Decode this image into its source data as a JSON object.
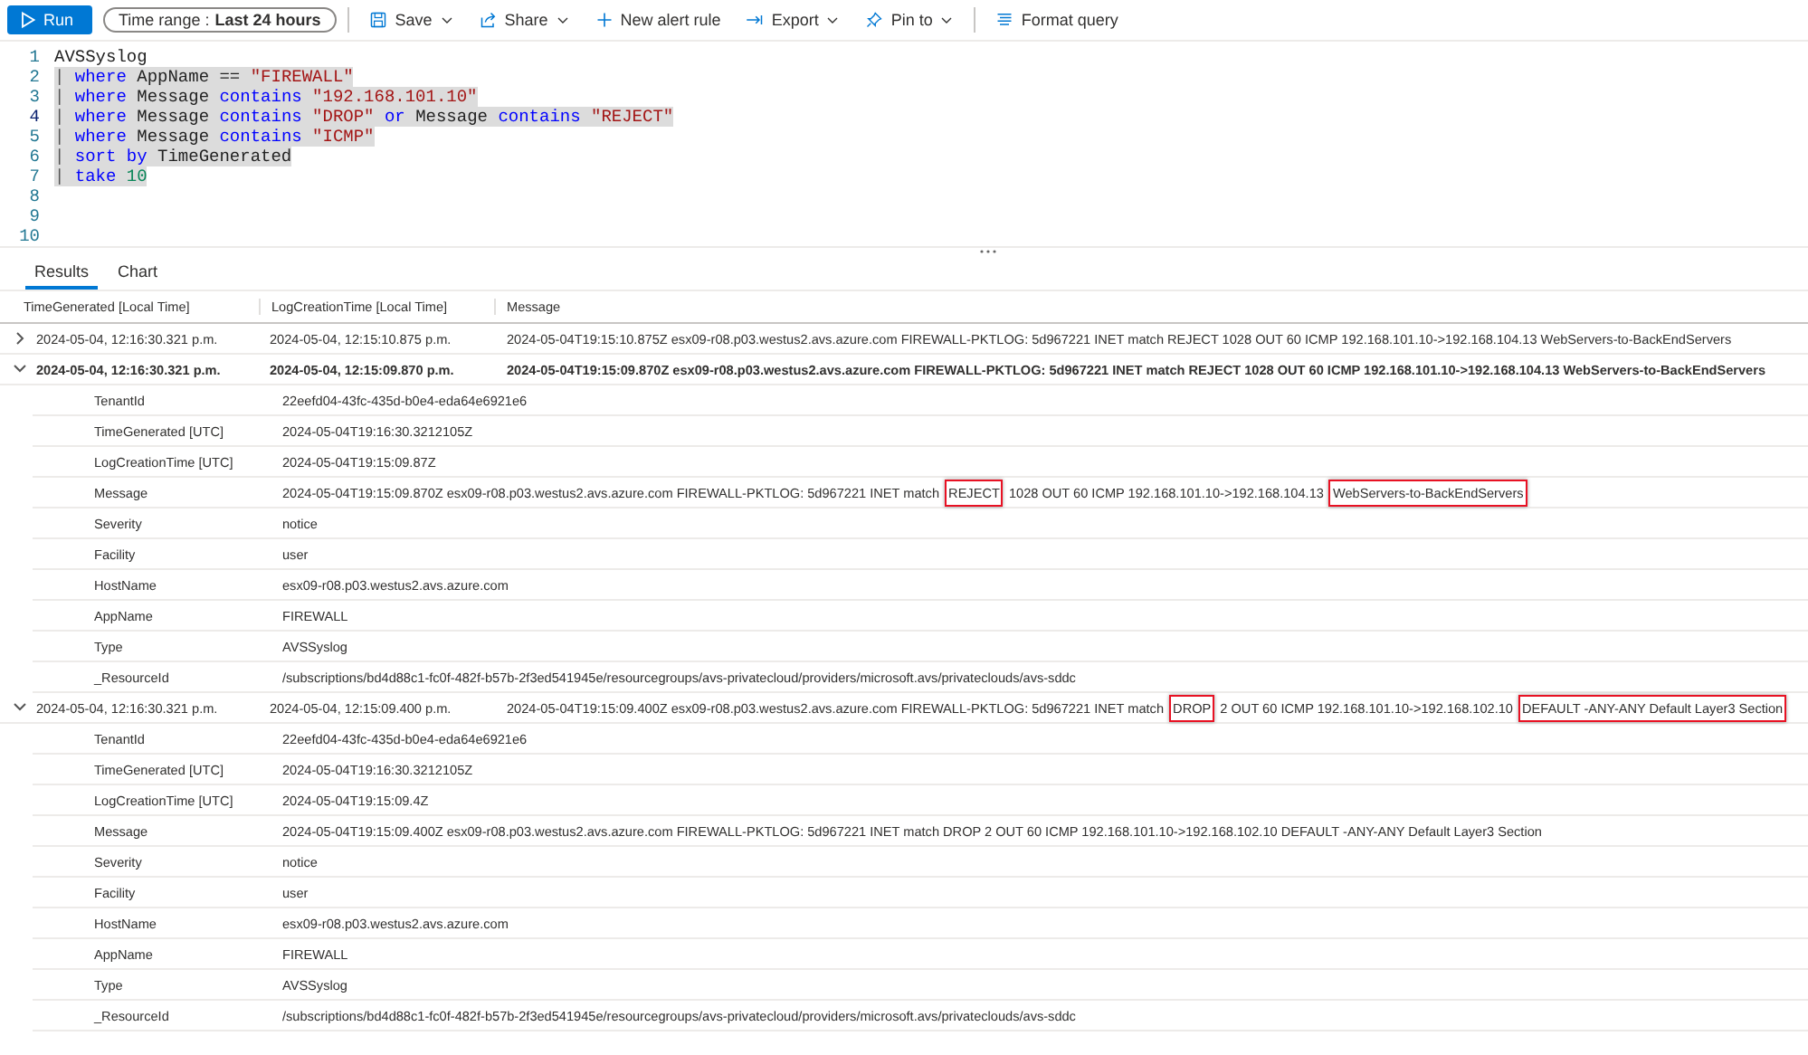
{
  "toolbar": {
    "run_button": {
      "label": "Run"
    },
    "time_range": {
      "label": "Time range :",
      "value": "Last 24 hours"
    },
    "items": [
      {
        "kind": "save",
        "label": "Save",
        "dropdown": true
      },
      {
        "kind": "share",
        "label": "Share",
        "dropdown": true
      },
      {
        "kind": "alert",
        "label": "New alert rule",
        "dropdown": false
      },
      {
        "kind": "export",
        "label": "Export",
        "dropdown": true
      },
      {
        "kind": "pin",
        "label": "Pin to",
        "dropdown": true
      },
      {
        "kind": "format",
        "label": "Format query",
        "dropdown": false
      }
    ]
  },
  "editor": {
    "lines": [
      {
        "number": "1",
        "selected": false,
        "current": false,
        "tokens": [
          {
            "kind": "plain",
            "text": "AVSSyslog"
          }
        ]
      },
      {
        "number": "2",
        "selected": true,
        "current": false,
        "tokens": [
          {
            "kind": "pipe",
            "text": "|"
          },
          {
            "kind": "keyword",
            "text": " where"
          },
          {
            "kind": "plain",
            "text": " AppName == "
          },
          {
            "kind": "string",
            "text": "\"FIREWALL\""
          }
        ]
      },
      {
        "number": "3",
        "selected": true,
        "current": false,
        "tokens": [
          {
            "kind": "pipe",
            "text": "|"
          },
          {
            "kind": "keyword",
            "text": " where"
          },
          {
            "kind": "plain",
            "text": " Message "
          },
          {
            "kind": "keyword",
            "text": "contains"
          },
          {
            "kind": "string",
            "text": " \"192.168.101.10\""
          }
        ]
      },
      {
        "number": "4",
        "selected": true,
        "current": true,
        "tokens": [
          {
            "kind": "pipe",
            "text": "|"
          },
          {
            "kind": "keyword",
            "text": " where"
          },
          {
            "kind": "plain",
            "text": " Message "
          },
          {
            "kind": "keyword",
            "text": "contains"
          },
          {
            "kind": "string",
            "text": " \"DROP\""
          },
          {
            "kind": "keyword",
            "text": " or"
          },
          {
            "kind": "plain",
            "text": " Message "
          },
          {
            "kind": "keyword",
            "text": "contains"
          },
          {
            "kind": "string",
            "text": " \"REJECT\""
          }
        ]
      },
      {
        "number": "5",
        "selected": true,
        "current": false,
        "tokens": [
          {
            "kind": "pipe",
            "text": "|"
          },
          {
            "kind": "keyword",
            "text": " where"
          },
          {
            "kind": "plain",
            "text": " Message "
          },
          {
            "kind": "keyword",
            "text": "contains"
          },
          {
            "kind": "string",
            "text": " \"ICMP\""
          }
        ]
      },
      {
        "number": "6",
        "selected": true,
        "current": false,
        "tokens": [
          {
            "kind": "pipe",
            "text": "|"
          },
          {
            "kind": "keyword",
            "text": " sort by"
          },
          {
            "kind": "plain",
            "text": " TimeGenerated"
          }
        ]
      },
      {
        "number": "7",
        "selected": true,
        "current": false,
        "tokens": [
          {
            "kind": "pipe",
            "text": "|"
          },
          {
            "kind": "keyword",
            "text": " take"
          },
          {
            "kind": "number",
            "text": " 10"
          }
        ]
      },
      {
        "number": "8",
        "current": false
      },
      {
        "number": "9",
        "current": false
      },
      {
        "number": "10",
        "current": false
      }
    ]
  },
  "tabs": [
    {
      "label": "Results",
      "selected": true
    },
    {
      "label": "Chart",
      "selected": false
    }
  ],
  "table": {
    "columns": [
      "TimeGenerated [Local Time]",
      "LogCreationTime [Local Time]",
      "Message"
    ],
    "rows": [
      {
        "expanded": false,
        "selected": false,
        "cells": [
          "2024-05-04, 12:16:30.321 p.m.",
          "2024-05-04, 12:15:10.875 p.m."
        ],
        "message": [
          {
            "text": "2024-05-04T19:15:10.875Z esx09-r08.p03.westus2.avs.azure.com FIREWALL-PKTLOG: 5d967221 INET match REJECT 1028 OUT 60 ICMP 192.168.101.10->192.168.104.13 WebServers-to-BackEndServers",
            "highlighted": false
          }
        ],
        "details": []
      },
      {
        "expanded": true,
        "selected": true,
        "cells": [
          "2024-05-04, 12:16:30.321 p.m.",
          "2024-05-04, 12:15:09.870 p.m."
        ],
        "message": [
          {
            "text": "2024-05-04T19:15:09.870Z esx09-r08.p03.westus2.avs.azure.com FIREWALL-PKTLOG: 5d967221 INET match REJECT 1028 OUT 60 ICMP 192.168.101.10->192.168.104.13 WebServers-to-BackEndServers",
            "highlighted": false
          }
        ],
        "details": [
          {
            "label": "TenantId",
            "value": [
              {
                "text": "22eefd04-43fc-435d-b0e4-eda64e6921e6",
                "highlighted": false
              }
            ]
          },
          {
            "label": "TimeGenerated [UTC]",
            "value": [
              {
                "text": "2024-05-04T19:16:30.3212105Z",
                "highlighted": false
              }
            ]
          },
          {
            "label": "LogCreationTime [UTC]",
            "value": [
              {
                "text": "2024-05-04T19:15:09.87Z",
                "highlighted": false
              }
            ]
          },
          {
            "label": "Message",
            "value": [
              {
                "text": "2024-05-04T19:15:09.870Z esx09-r08.p03.westus2.avs.azure.com FIREWALL-PKTLOG: 5d967221 INET match ",
                "highlighted": false
              },
              {
                "text": "REJECT",
                "highlighted": true
              },
              {
                "text": " 1028 OUT 60 ICMP 192.168.101.10->192.168.104.13 ",
                "highlighted": false
              },
              {
                "text": "WebServers-to-BackEndServers",
                "highlighted": true
              }
            ]
          },
          {
            "label": "Severity",
            "value": [
              {
                "text": "notice",
                "highlighted": false
              }
            ]
          },
          {
            "label": "Facility",
            "value": [
              {
                "text": "user",
                "highlighted": false
              }
            ]
          },
          {
            "label": "HostName",
            "value": [
              {
                "text": "esx09-r08.p03.westus2.avs.azure.com",
                "highlighted": false
              }
            ]
          },
          {
            "label": "AppName",
            "value": [
              {
                "text": "FIREWALL",
                "highlighted": false
              }
            ]
          },
          {
            "label": "Type",
            "value": [
              {
                "text": "AVSSyslog",
                "highlighted": false
              }
            ]
          },
          {
            "label": "_ResourceId",
            "value": [
              {
                "text": "/subscriptions/bd4d88c1-fc0f-482f-b57b-2f3ed541945e/resourcegroups/avs-privatecloud/providers/microsoft.avs/privateclouds/avs-sddc",
                "highlighted": false
              }
            ]
          }
        ]
      },
      {
        "expanded": true,
        "selected": false,
        "cells": [
          "2024-05-04, 12:16:30.321 p.m.",
          "2024-05-04, 12:15:09.400 p.m."
        ],
        "message": [
          {
            "text": "2024-05-04T19:15:09.400Z esx09-r08.p03.westus2.avs.azure.com FIREWALL-PKTLOG: 5d967221 INET match ",
            "highlighted": false
          },
          {
            "text": "DROP",
            "highlighted": true
          },
          {
            "text": " 2 OUT 60 ICMP 192.168.101.10->192.168.102.10 ",
            "highlighted": false
          },
          {
            "text": "DEFAULT -ANY-ANY Default Layer3 Section",
            "highlighted": true
          }
        ],
        "details": [
          {
            "label": "TenantId",
            "value": [
              {
                "text": "22eefd04-43fc-435d-b0e4-eda64e6921e6",
                "highlighted": false
              }
            ]
          },
          {
            "label": "TimeGenerated [UTC]",
            "value": [
              {
                "text": "2024-05-04T19:16:30.3212105Z",
                "highlighted": false
              }
            ]
          },
          {
            "label": "LogCreationTime [UTC]",
            "value": [
              {
                "text": "2024-05-04T19:15:09.4Z",
                "highlighted": false
              }
            ]
          },
          {
            "label": "Message",
            "value": [
              {
                "text": "2024-05-04T19:15:09.400Z esx09-r08.p03.westus2.avs.azure.com FIREWALL-PKTLOG: 5d967221 INET match DROP 2 OUT 60 ICMP 192.168.101.10->192.168.102.10 DEFAULT -ANY-ANY Default Layer3 Section",
                "highlighted": false
              }
            ]
          },
          {
            "label": "Severity",
            "value": [
              {
                "text": "notice",
                "highlighted": false
              }
            ]
          },
          {
            "label": "Facility",
            "value": [
              {
                "text": "user",
                "highlighted": false
              }
            ]
          },
          {
            "label": "HostName",
            "value": [
              {
                "text": "esx09-r08.p03.westus2.avs.azure.com",
                "highlighted": false
              }
            ]
          },
          {
            "label": "AppName",
            "value": [
              {
                "text": "FIREWALL",
                "highlighted": false
              }
            ]
          },
          {
            "label": "Type",
            "value": [
              {
                "text": "AVSSyslog",
                "highlighted": false
              }
            ]
          },
          {
            "label": "_ResourceId",
            "value": [
              {
                "text": "/subscriptions/bd4d88c1-fc0f-482f-b57b-2f3ed541945e/resourcegroups/avs-privatecloud/providers/microsoft.avs/privateclouds/avs-sddc",
                "highlighted": false
              }
            ]
          }
        ]
      }
    ]
  }
}
